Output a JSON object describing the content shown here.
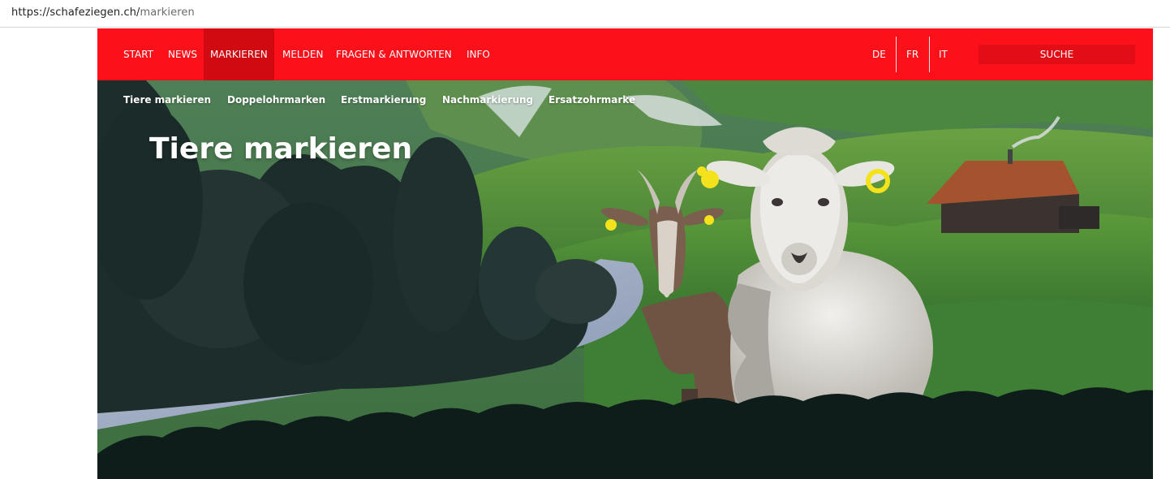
{
  "browser": {
    "url_host": "https://schafeziegen.ch/",
    "url_path": "markieren"
  },
  "topnav": {
    "items": [
      {
        "label": "START"
      },
      {
        "label": "NEWS"
      },
      {
        "label": "MARKIEREN",
        "active": true
      },
      {
        "label": "MELDEN"
      },
      {
        "label": "FRAGEN & ANTWORTEN"
      },
      {
        "label": "INFO"
      }
    ],
    "languages": [
      "DE",
      "FR",
      "IT"
    ],
    "search_label": "SUCHE"
  },
  "subnav": {
    "items": [
      {
        "label": "Tiere markieren"
      },
      {
        "label": "Doppelohrmarken"
      },
      {
        "label": "Erstmarkierung"
      },
      {
        "label": "Nachmarkierung"
      },
      {
        "label": "Ersatzohrmarke"
      }
    ]
  },
  "hero": {
    "title": "Tiere markieren"
  },
  "colors": {
    "brand_red": "#fc101a",
    "active_red": "#d10a12",
    "ear_tag_yellow": "#f3e21c"
  }
}
